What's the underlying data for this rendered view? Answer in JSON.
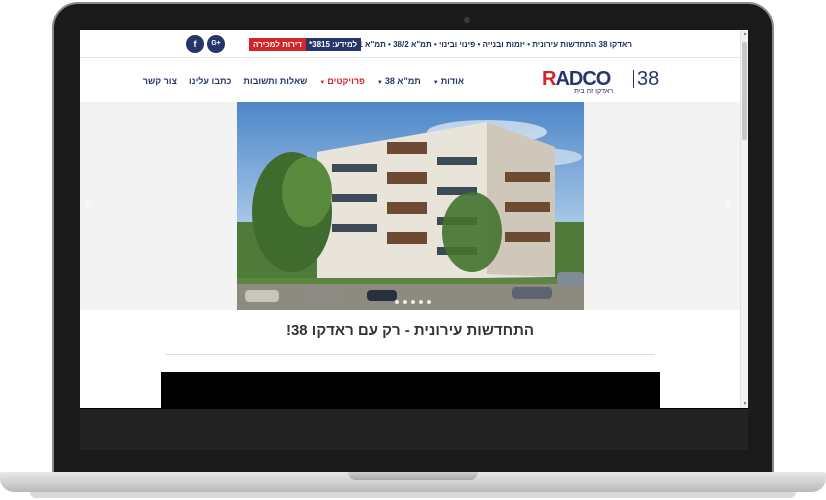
{
  "topbar": {
    "strip_text": "ראדקו 38 התחדשות עירונית • יזמות ובנייה • פינוי ובינוי • תמ\"א 38/2 • תמ\"א 38/1",
    "phone_label": "למידע: 3815*",
    "sale_label": "דירות למכירה",
    "social": [
      {
        "icon": "facebook-icon",
        "glyph": "f"
      },
      {
        "icon": "google-plus-icon",
        "glyph": "G+"
      }
    ]
  },
  "logo": {
    "letter_r": "R",
    "brand": "ADCO",
    "number": "38",
    "tagline": "ראדקו זה בית"
  },
  "nav": {
    "items": [
      {
        "label": "אודות",
        "has_caret": true,
        "active": false
      },
      {
        "label": "תמ\"א 38",
        "has_caret": true,
        "active": false
      },
      {
        "label": "פרויקטים",
        "has_caret": true,
        "active": true
      },
      {
        "label": "שאלות ותשובות",
        "has_caret": false,
        "active": false
      },
      {
        "label": "כתבו עלינו",
        "has_caret": false,
        "active": false
      },
      {
        "label": "צור קשר",
        "has_caret": false,
        "active": false
      }
    ],
    "caret_glyph": "▼"
  },
  "hero": {
    "arrow_left": "‹",
    "arrow_right": "›",
    "slide_count": 5
  },
  "content": {
    "headline": "התחדשות עירונית - רק עם ראדקו 38!"
  },
  "colors": {
    "brand_navy": "#26366a",
    "brand_red": "#d5232a"
  }
}
